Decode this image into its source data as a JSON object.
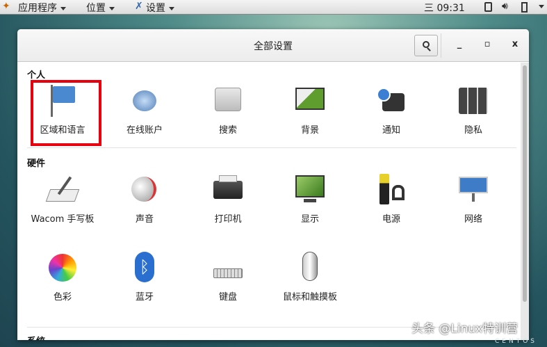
{
  "topbar": {
    "applications": "应用程序",
    "places": "位置",
    "settings": "设置",
    "day": "三",
    "time": "09:31"
  },
  "window": {
    "title": "全部设置",
    "minimize": "_",
    "maximize": "▫",
    "close": "x"
  },
  "sections": {
    "personal": {
      "title": "个人",
      "items": [
        "区域和语言",
        "在线账户",
        "搜索",
        "背景",
        "通知",
        "隐私"
      ]
    },
    "hardware": {
      "title": "硬件",
      "items": [
        "Wacom 手写板",
        "声音",
        "打印机",
        "显示",
        "电源",
        "网络",
        "色彩",
        "蓝牙",
        "键盘",
        "鼠标和触摸板"
      ]
    },
    "system": {
      "title": "系统"
    }
  },
  "watermark": "头条 @Linux特训营",
  "brand": "CENTOS",
  "highlight_color": "#e8000f"
}
